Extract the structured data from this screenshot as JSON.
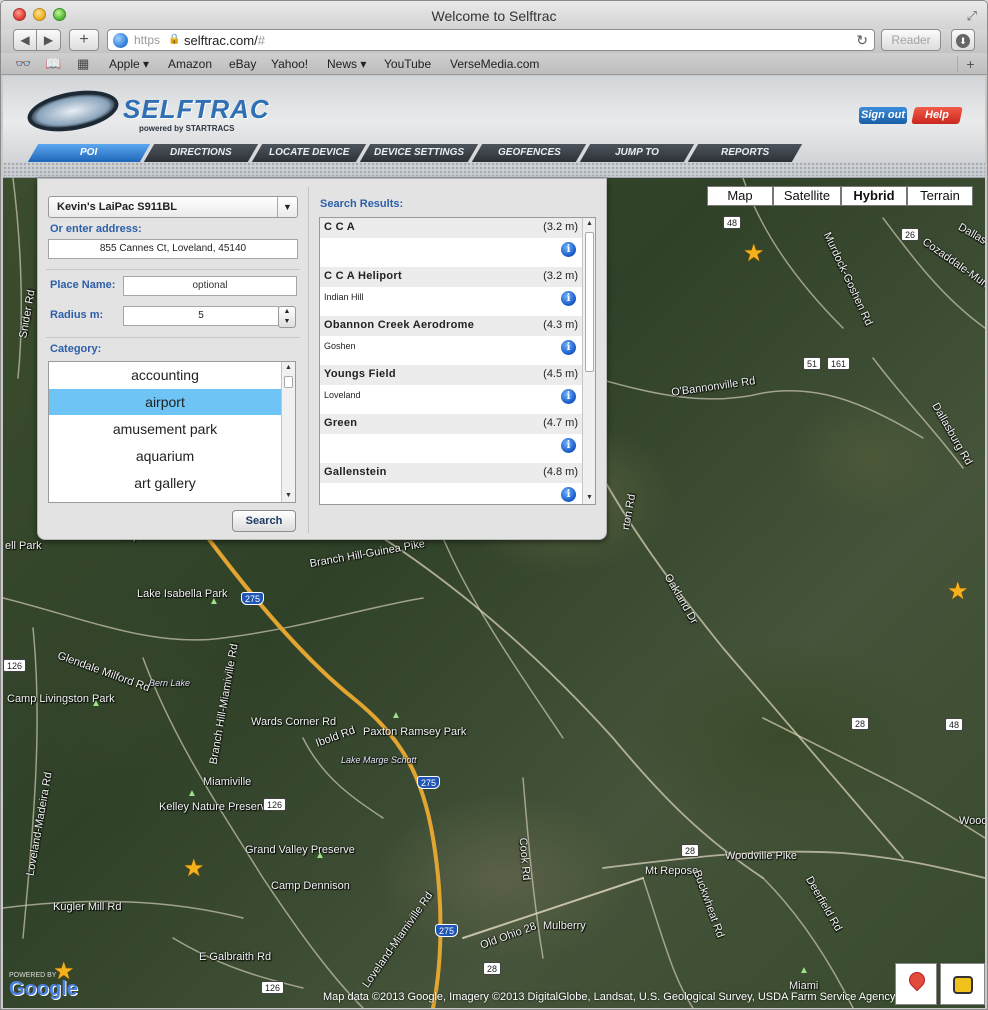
{
  "browser": {
    "window_title": "Welcome to Selftrac",
    "url_scheme": "https",
    "url_host": "selftrac.com/",
    "url_path": "#",
    "reader_label": "Reader",
    "bookmarks": [
      {
        "label": "Apple ▾"
      },
      {
        "label": "Amazon"
      },
      {
        "label": "eBay"
      },
      {
        "label": "Yahoo!"
      },
      {
        "label": "News ▾"
      },
      {
        "label": "YouTube"
      },
      {
        "label": "VerseMedia.com"
      }
    ]
  },
  "header": {
    "logo_text": "SELFTRAC",
    "logo_sub": "powered by STARTRACS",
    "sign_out": "Sign out",
    "help": "Help",
    "nav_tabs": [
      {
        "label": "POI",
        "active": true
      },
      {
        "label": "DIRECTIONS"
      },
      {
        "label": "LOCATE DEVICE"
      },
      {
        "label": "DEVICE SETTINGS"
      },
      {
        "label": "GEOFENCES"
      },
      {
        "label": "JUMP TO"
      },
      {
        "label": "REPORTS"
      }
    ]
  },
  "poi_panel": {
    "device": "Kevin's LaiPac S911BL",
    "address_label": "Or enter address:",
    "address_value": "855 Cannes Ct, Loveland, 45140",
    "place_name_label": "Place Name:",
    "place_name_placeholder": "optional",
    "radius_label": "Radius m:",
    "radius_value": "5",
    "category_label": "Category:",
    "categories": [
      "accounting",
      "airport",
      "amusement park",
      "aquarium",
      "art gallery"
    ],
    "selected_category": "airport",
    "search_label": "Search",
    "results_label": "Search Results:",
    "results": [
      {
        "name": "C C A",
        "distance": "(3.2 m)",
        "sub": ""
      },
      {
        "name": "C C A Heliport",
        "distance": "(3.2 m)",
        "sub": "Indian Hill"
      },
      {
        "name": "Obannon Creek Aerodrome",
        "distance": "(4.3 m)",
        "sub": "Goshen"
      },
      {
        "name": "Youngs Field",
        "distance": "(4.5 m)",
        "sub": "Loveland"
      },
      {
        "name": "Green",
        "distance": "(4.7 m)",
        "sub": ""
      },
      {
        "name": "Gallenstein",
        "distance": "(4.8 m)",
        "sub": ""
      }
    ]
  },
  "map": {
    "map_types": [
      {
        "label": "Map"
      },
      {
        "label": "Satellite"
      },
      {
        "label": "Hybrid",
        "active": true
      },
      {
        "label": "Terrain"
      }
    ],
    "labels": [
      "Hopewell Meadows Park",
      "Lake Isabella Park",
      "Bern Lake",
      "Camp Livingston Park",
      "Wards Corner Rd",
      "Paxton Ramsey Park",
      "Lake Marge Schott",
      "Miamiville",
      "Kelley Nature Preserve",
      "Grand Valley Preserve",
      "Camp Dennison",
      "Kugler Mill Rd",
      "E Galbraith Rd",
      "Loveland-Madeira Rd",
      "Glendale Milford Rd",
      "Branch Hill-Miamiville Rd",
      "Branch Hill-Guinea Pike",
      "Oakland Dr",
      "O'Bannonville Rd",
      "Murdock-Goshen Rd",
      "Dallasburg Rd",
      "Cozaddale-Murdock Rd",
      "Woodville Pike",
      "Mt Repose",
      "Buckwheat Rd",
      "Deerfield Rd",
      "Cook Rd",
      "Mulberry",
      "Old Ohio 28",
      "Loveland-Miamiville Rd",
      "Ibold Rd",
      "Snider Rd",
      "Miami",
      "ell Park",
      "rton Rd",
      "Dallas",
      "Wood"
    ],
    "shields": [
      "48",
      "26",
      "51",
      "161",
      "275",
      "275",
      "275",
      "126",
      "126",
      "28",
      "28",
      "28",
      "48",
      "126"
    ],
    "google": "Google",
    "powered": "POWERED BY",
    "attribution": "Map data ©2013 Google, Imagery ©2013 DigitalGlobe, Landsat, U.S. Geological Survey, USDA Farm Service Agency"
  }
}
